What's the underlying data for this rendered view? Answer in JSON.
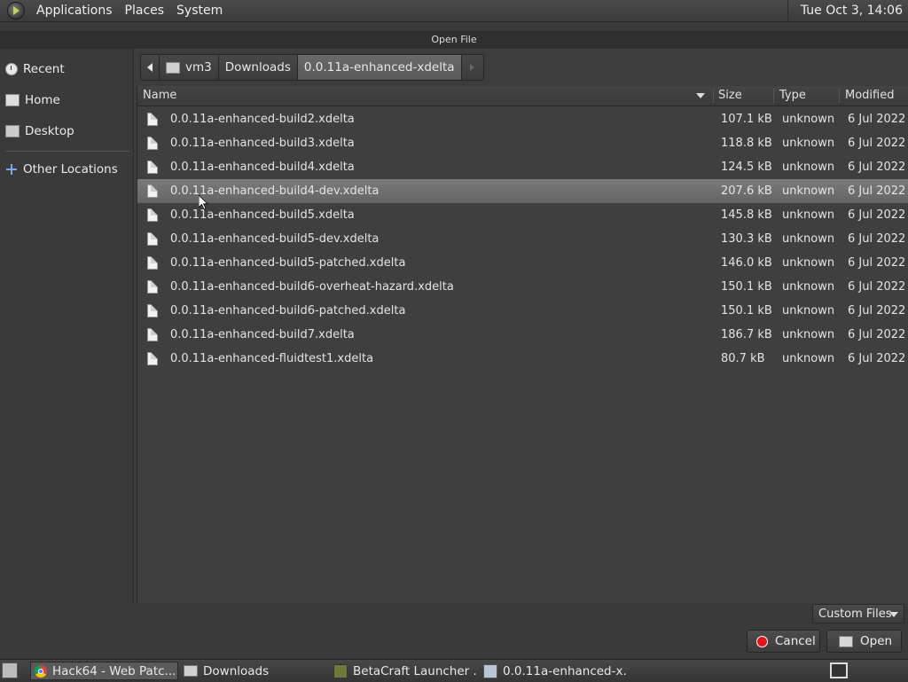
{
  "top_panel": {
    "menus": [
      "Applications",
      "Places",
      "System"
    ],
    "clock": "Tue Oct  3, 14:06"
  },
  "dialog": {
    "title": "Open File"
  },
  "sidebar": {
    "items": [
      {
        "label": "Recent",
        "icon": "clock-icon"
      },
      {
        "label": "Home",
        "icon": "home-folder-icon"
      },
      {
        "label": "Desktop",
        "icon": "desktop-icon"
      },
      {
        "label": "Other Locations",
        "icon": "plus-icon"
      }
    ]
  },
  "pathbar": {
    "segments": [
      "vm3",
      "Downloads",
      "0.0.11a-enhanced-xdelta"
    ],
    "active_index": 2
  },
  "file_list": {
    "columns": [
      "Name",
      "Size",
      "Type",
      "Modified"
    ],
    "sort_column": "Name",
    "selected_index": 3,
    "rows": [
      {
        "name": "0.0.11a-enhanced-build2.xdelta",
        "size": "107.1 kB",
        "type": "unknown",
        "modified": "6 Jul 2022"
      },
      {
        "name": "0.0.11a-enhanced-build3.xdelta",
        "size": "118.8 kB",
        "type": "unknown",
        "modified": "6 Jul 2022"
      },
      {
        "name": "0.0.11a-enhanced-build4.xdelta",
        "size": "124.5 kB",
        "type": "unknown",
        "modified": "6 Jul 2022"
      },
      {
        "name": "0.0.11a-enhanced-build4-dev.xdelta",
        "size": "207.6 kB",
        "type": "unknown",
        "modified": "6 Jul 2022"
      },
      {
        "name": "0.0.11a-enhanced-build5.xdelta",
        "size": "145.8 kB",
        "type": "unknown",
        "modified": "6 Jul 2022"
      },
      {
        "name": "0.0.11a-enhanced-build5-dev.xdelta",
        "size": "130.3 kB",
        "type": "unknown",
        "modified": "6 Jul 2022"
      },
      {
        "name": "0.0.11a-enhanced-build5-patched.xdelta",
        "size": "146.0 kB",
        "type": "unknown",
        "modified": "6 Jul 2022"
      },
      {
        "name": "0.0.11a-enhanced-build6-overheat-hazard.xdelta",
        "size": "150.1 kB",
        "type": "unknown",
        "modified": "6 Jul 2022"
      },
      {
        "name": "0.0.11a-enhanced-build6-patched.xdelta",
        "size": "150.1 kB",
        "type": "unknown",
        "modified": "6 Jul 2022"
      },
      {
        "name": "0.0.11a-enhanced-build7.xdelta",
        "size": "186.7 kB",
        "type": "unknown",
        "modified": "6 Jul 2022"
      },
      {
        "name": "0.0.11a-enhanced-fluidtest1.xdelta",
        "size": "80.7 kB",
        "type": "unknown",
        "modified": "6 Jul 2022"
      }
    ]
  },
  "controls": {
    "filter_label": "Custom Files",
    "cancel_label": "Cancel",
    "open_label": "Open"
  },
  "taskbar": {
    "tasks": [
      {
        "label": "Hack64 - Web Patc...",
        "icon": "chrome-icon",
        "active": true
      },
      {
        "label": "Downloads",
        "icon": "folder-icon",
        "active": false
      },
      {
        "label": "BetaCraft Launcher ...",
        "icon": "betacraft-icon",
        "active": false
      },
      {
        "label": "0.0.11a-enhanced-x...",
        "icon": "file-dialog-icon",
        "active": false
      }
    ]
  }
}
